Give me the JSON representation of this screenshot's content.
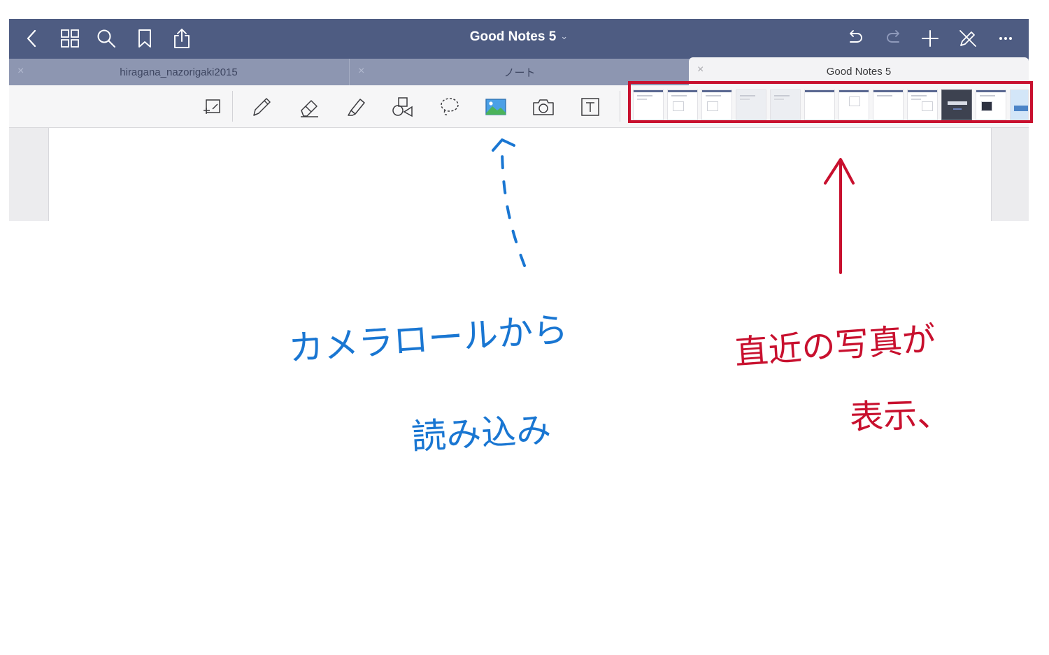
{
  "navbar": {
    "title": "Good Notes 5",
    "title_chevron": "⌄"
  },
  "tabs": [
    {
      "label": "hiragana_nazorigaki2015",
      "close": "×"
    },
    {
      "label": "ノート",
      "close": "×"
    },
    {
      "label": "Good Notes 5",
      "close": "×",
      "active": true
    }
  ],
  "annotations": {
    "blue_line1": "カメラロールから",
    "blue_line2": "読み込み",
    "red_line1": "直近の写真が",
    "red_line2": "表示、"
  },
  "colors": {
    "navbar": "#4e5c82",
    "tabbar": "#8d96b1",
    "accent_blue": "#1976d2",
    "accent_red": "#c8102e"
  }
}
